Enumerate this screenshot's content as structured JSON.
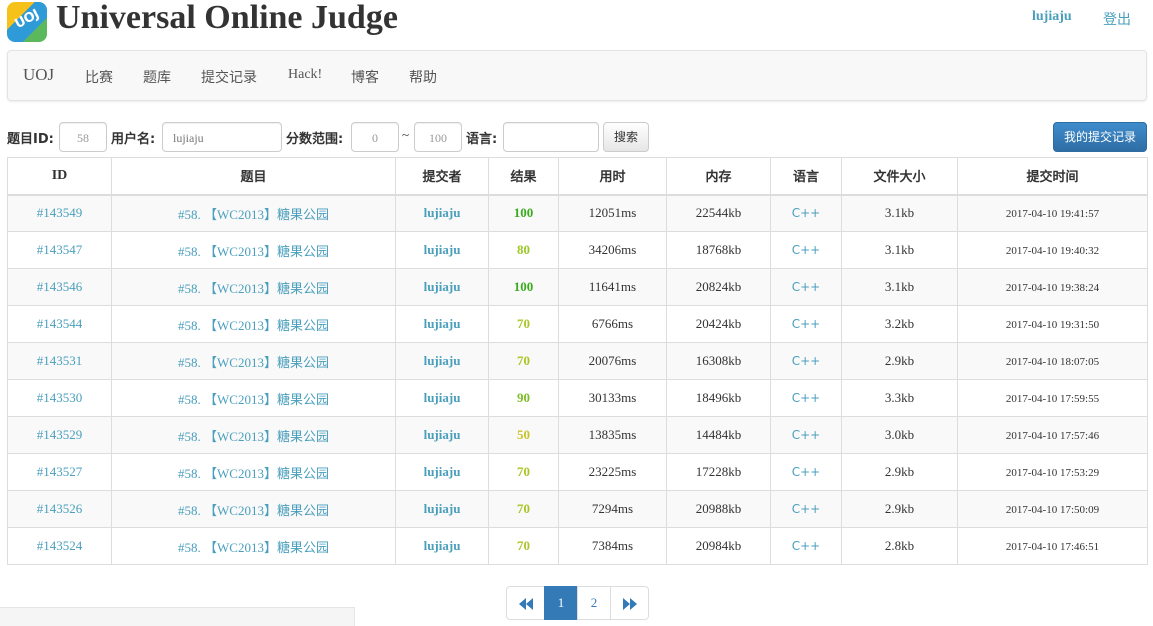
{
  "header": {
    "logo_text": "UOJ",
    "title": "Universal Online Judge",
    "username": "lujiaju",
    "logout": "登出"
  },
  "nav": {
    "brand": "UOJ",
    "items": [
      "比赛",
      "题库",
      "提交记录",
      "Hack!",
      "博客",
      "帮助"
    ]
  },
  "filter": {
    "problem_id_label": "题目ID:",
    "problem_id_value": "58",
    "username_label": "用户名:",
    "username_value": "lujiaju",
    "score_label": "分数范围:",
    "score_min": "0",
    "score_sep": "~",
    "score_max": "100",
    "language_label": "语言:",
    "language_value": "",
    "search_button": "搜索",
    "my_submissions_button": "我的提交记录"
  },
  "table": {
    "headers": [
      "ID",
      "题目",
      "提交者",
      "结果",
      "用时",
      "内存",
      "语言",
      "文件大小",
      "提交时间"
    ],
    "rows": [
      {
        "id": "#143549",
        "problem": "#58. 【WC2013】糖果公园",
        "user": "lujiaju",
        "score": "100",
        "time": "12051ms",
        "memory": "22544kb",
        "lang": "C++",
        "size": "3.1kb",
        "submit_time": "2017-04-10 19:41:57"
      },
      {
        "id": "#143547",
        "problem": "#58. 【WC2013】糖果公园",
        "user": "lujiaju",
        "score": "80",
        "time": "34206ms",
        "memory": "18768kb",
        "lang": "C++",
        "size": "3.1kb",
        "submit_time": "2017-04-10 19:40:32"
      },
      {
        "id": "#143546",
        "problem": "#58. 【WC2013】糖果公园",
        "user": "lujiaju",
        "score": "100",
        "time": "11641ms",
        "memory": "20824kb",
        "lang": "C++",
        "size": "3.1kb",
        "submit_time": "2017-04-10 19:38:24"
      },
      {
        "id": "#143544",
        "problem": "#58. 【WC2013】糖果公园",
        "user": "lujiaju",
        "score": "70",
        "time": "6766ms",
        "memory": "20424kb",
        "lang": "C++",
        "size": "3.2kb",
        "submit_time": "2017-04-10 19:31:50"
      },
      {
        "id": "#143531",
        "problem": "#58. 【WC2013】糖果公园",
        "user": "lujiaju",
        "score": "70",
        "time": "20076ms",
        "memory": "16308kb",
        "lang": "C++",
        "size": "2.9kb",
        "submit_time": "2017-04-10 18:07:05"
      },
      {
        "id": "#143530",
        "problem": "#58. 【WC2013】糖果公园",
        "user": "lujiaju",
        "score": "90",
        "time": "30133ms",
        "memory": "18496kb",
        "lang": "C++",
        "size": "3.3kb",
        "submit_time": "2017-04-10 17:59:55"
      },
      {
        "id": "#143529",
        "problem": "#58. 【WC2013】糖果公园",
        "user": "lujiaju",
        "score": "50",
        "time": "13835ms",
        "memory": "14484kb",
        "lang": "C++",
        "size": "3.0kb",
        "submit_time": "2017-04-10 17:57:46"
      },
      {
        "id": "#143527",
        "problem": "#58. 【WC2013】糖果公园",
        "user": "lujiaju",
        "score": "70",
        "time": "23225ms",
        "memory": "17228kb",
        "lang": "C++",
        "size": "2.9kb",
        "submit_time": "2017-04-10 17:53:29"
      },
      {
        "id": "#143526",
        "problem": "#58. 【WC2013】糖果公园",
        "user": "lujiaju",
        "score": "70",
        "time": "7294ms",
        "memory": "20988kb",
        "lang": "C++",
        "size": "2.9kb",
        "submit_time": "2017-04-10 17:50:09"
      },
      {
        "id": "#143524",
        "problem": "#58. 【WC2013】糖果公园",
        "user": "lujiaju",
        "score": "70",
        "time": "7384ms",
        "memory": "20984kb",
        "lang": "C++",
        "size": "2.8kb",
        "submit_time": "2017-04-10 17:46:51"
      }
    ]
  },
  "score_colors": {
    "100": "#3caa1e",
    "90": "#7bbf24",
    "80": "#9bc925",
    "70": "#a8c626",
    "50": "#c9c32a"
  },
  "pagination": {
    "prev_icon": "double-chevron-left-icon",
    "pages": [
      "1",
      "2"
    ],
    "active_page": "1",
    "next_icon": "double-chevron-right-icon"
  }
}
